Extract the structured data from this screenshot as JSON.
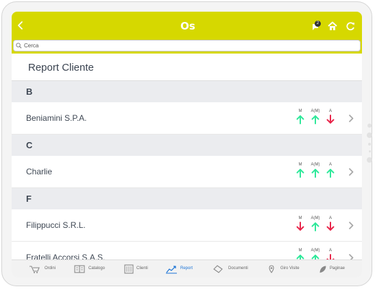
{
  "topbar": {
    "logo_text": "Os",
    "notification_count": "2",
    "icons": [
      "chevron-left-icon",
      "notification-icon",
      "home-icon",
      "sync-icon"
    ],
    "background_color": "#d6d800"
  },
  "search": {
    "placeholder": "Cerca",
    "value": ""
  },
  "header": {
    "title": "Report Cliente"
  },
  "indicator_labels": [
    "M",
    "A(M)",
    "A"
  ],
  "colors": {
    "up": "#2ee89a",
    "down": "#e8254a",
    "active_tab": "#1a73d6"
  },
  "sections": [
    {
      "letter": "B",
      "rows": [
        {
          "name": "Beniamini S.P.A.",
          "trends": [
            "up",
            "up",
            "down"
          ]
        }
      ]
    },
    {
      "letter": "C",
      "rows": [
        {
          "name": "Charlie",
          "trends": [
            "up",
            "up",
            "up"
          ]
        }
      ]
    },
    {
      "letter": "F",
      "rows": [
        {
          "name": "Filippucci S.R.L.",
          "trends": [
            "down",
            "up",
            "down"
          ]
        },
        {
          "name": "Fratelli Accorsi S.A.S.",
          "trends": [
            "up",
            "up",
            "down"
          ]
        }
      ]
    }
  ],
  "tabbar": {
    "active": "Report",
    "items": [
      {
        "label": "Ordini",
        "icon": "cart-icon"
      },
      {
        "label": "Catalogo",
        "icon": "book-icon"
      },
      {
        "label": "Clienti",
        "icon": "building-icon"
      },
      {
        "label": "Report",
        "icon": "chart-trend-icon"
      },
      {
        "label": "Documenti",
        "icon": "document-icon"
      },
      {
        "label": "Giro Visite",
        "icon": "map-pin-icon"
      },
      {
        "label": "Paginae",
        "icon": "leaf-icon"
      }
    ]
  }
}
